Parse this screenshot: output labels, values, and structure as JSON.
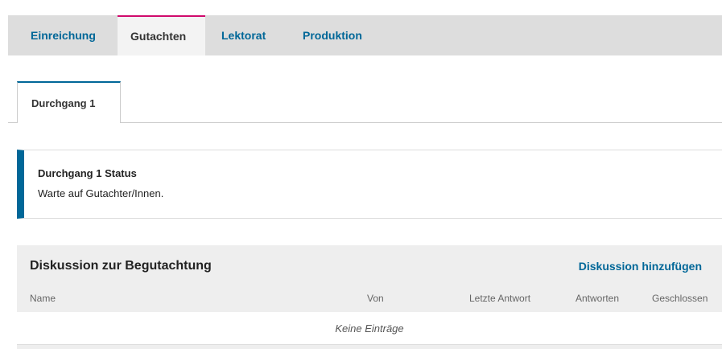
{
  "stage_tabs": [
    "Einreichung",
    "Gutachten",
    "Lektorat",
    "Produktion"
  ],
  "active_stage_tab": "Gutachten",
  "round_tab": {
    "label": "Durchgang 1"
  },
  "status": {
    "title": "Durchgang 1 Status",
    "text": "Warte auf Gutachter/Innen."
  },
  "discussion": {
    "title": "Diskussion zur Begutachtung",
    "add_label": "Diskussion hinzufügen",
    "columns": [
      "Name",
      "Von",
      "Letzte Antwort",
      "Antworten",
      "Geschlossen"
    ],
    "empty_text": "Keine Einträge"
  },
  "colors": {
    "accent": "#006798",
    "active_tab_border": "#d00a6c"
  }
}
